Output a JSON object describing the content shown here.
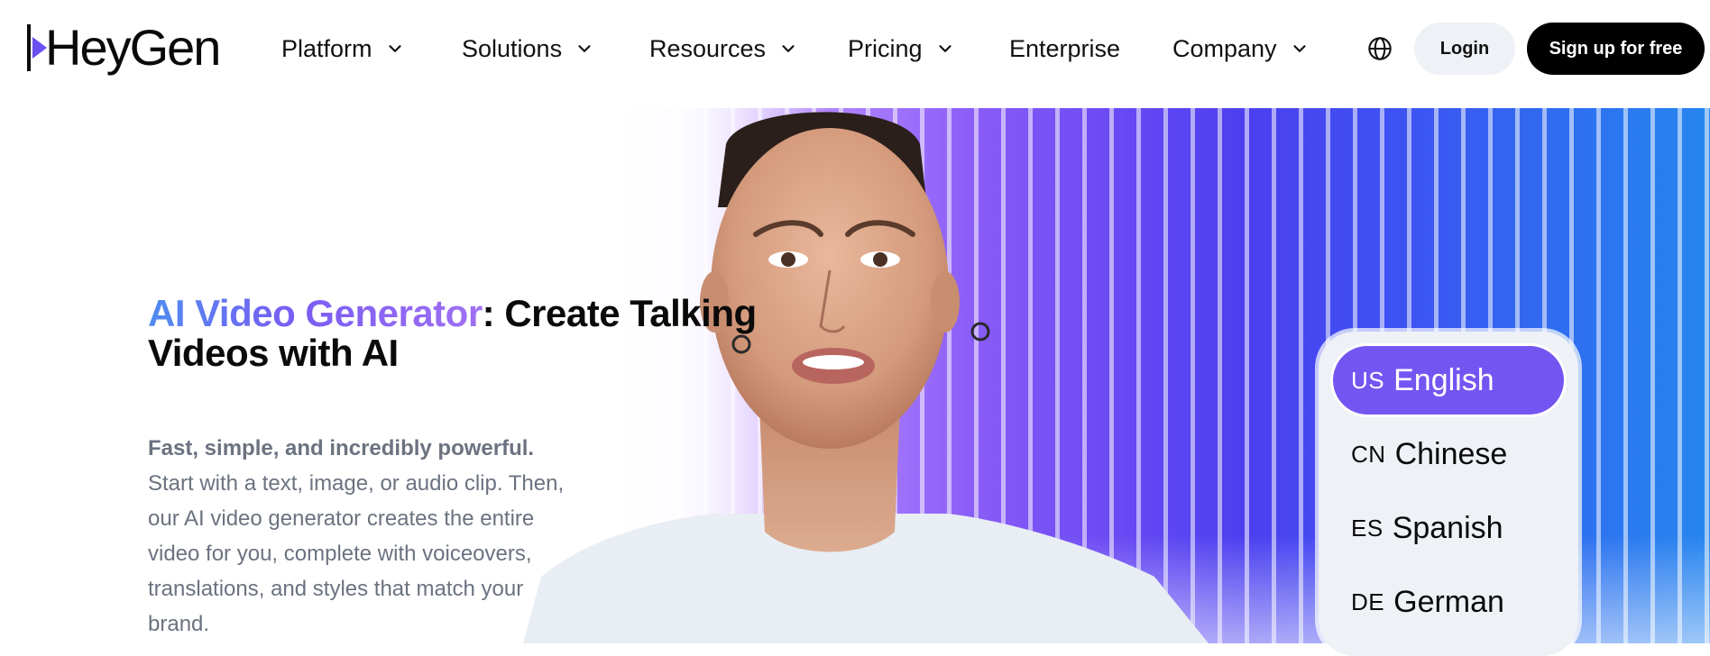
{
  "brand": {
    "name": "HeyGen",
    "accent": "#6a4ff2"
  },
  "nav": {
    "items": [
      {
        "label": "Platform",
        "has_dropdown": true
      },
      {
        "label": "Solutions",
        "has_dropdown": true
      },
      {
        "label": "Resources",
        "has_dropdown": true
      },
      {
        "label": "Pricing",
        "has_dropdown": true
      },
      {
        "label": "Enterprise",
        "has_dropdown": false
      },
      {
        "label": "Company",
        "has_dropdown": true
      }
    ],
    "language_icon": "globe-icon",
    "login_label": "Login",
    "signup_label": "Sign up for free"
  },
  "hero": {
    "headline_highlight": "AI Video Generator",
    "headline_rest": ": Create Talking Videos with AI",
    "lead": "Fast, simple, and incredibly powerful.",
    "body": "Start with a text, image, or audio clip. Then, our AI video generator creates the entire video for you, complete with voiceovers, translations, and styles that match your brand."
  },
  "languages": {
    "selected_index": 0,
    "items": [
      {
        "code": "US",
        "label": "English"
      },
      {
        "code": "CN",
        "label": "Chinese"
      },
      {
        "code": "ES",
        "label": "Spanish"
      },
      {
        "code": "DE",
        "label": "German"
      }
    ]
  },
  "colors": {
    "selected_language_bg": "#7356f2",
    "signup_bg": "#000000",
    "login_bg": "#eef1f5",
    "headline_gradient": [
      "#4f8cf0",
      "#7a5cf4",
      "#a070f2"
    ]
  }
}
